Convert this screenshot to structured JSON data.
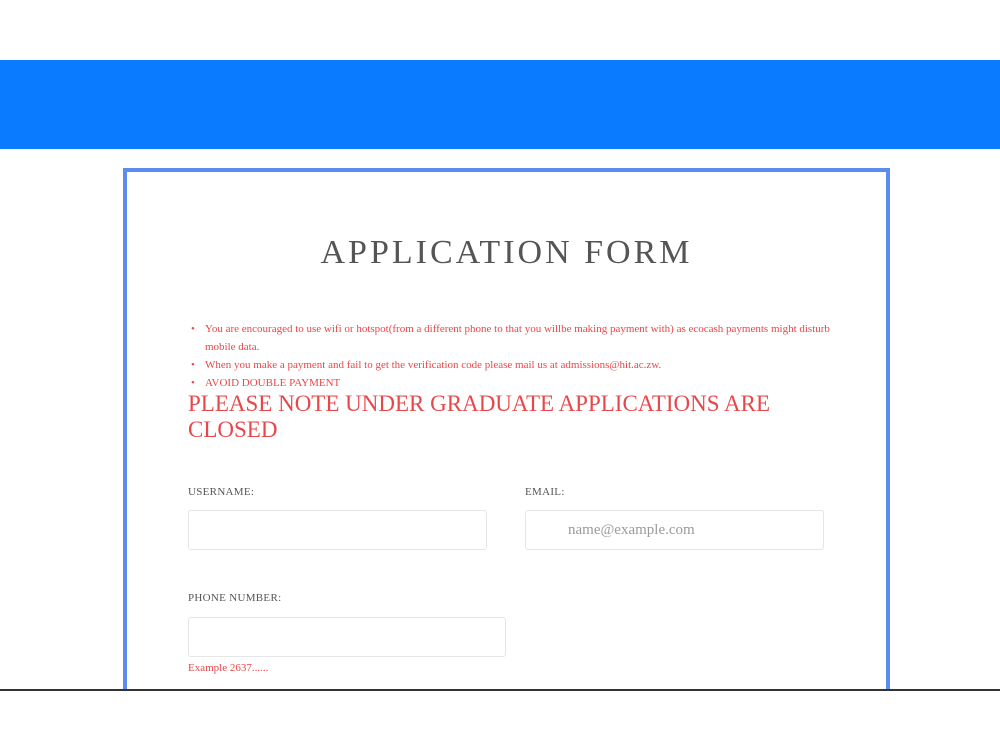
{
  "form": {
    "title": "APPLICATION FORM",
    "notices": [
      "You are encouraged to use wifi or hotspot(from a different phone to that you willbe making payment with) as ecocash payments might disturb mobile data.",
      "When you make a payment and fail to get the verification code please mail us at admissions@hit.ac.zw.",
      "AVOID DOUBLE PAYMENT"
    ],
    "closed_notice": "PLEASE NOTE UNDER GRADUATE APPLICATIONS ARE CLOSED",
    "username": {
      "label": "USERNAME:",
      "value": "",
      "placeholder": ""
    },
    "email": {
      "label": "EMAIL:",
      "value": "",
      "placeholder": "name@example.com"
    },
    "phone": {
      "label": "PHONE NUMBER:",
      "value": "",
      "placeholder": "",
      "hint": "Example 2637......"
    }
  },
  "colors": {
    "banner": "#0a7bff",
    "card_border": "#5b8def",
    "warning_text": "#e8474a",
    "title_text": "#555555"
  }
}
